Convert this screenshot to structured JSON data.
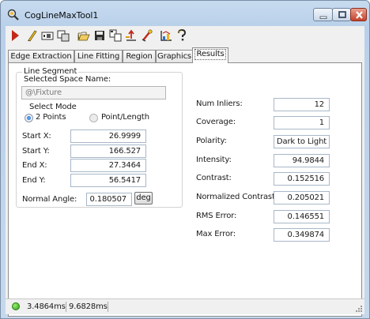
{
  "window": {
    "title": "CogLineMaxTool1"
  },
  "colors": {
    "accent": "#1a5fbf",
    "status_ok": "#2f9e1c",
    "title_gradient": "#b9d0ea",
    "close_button": "#c4422b"
  },
  "toolbar": {
    "buttons": [
      "run-icon",
      "edit-tool-icon",
      "image-display-icon",
      "copy-image-icon",
      "open-icon",
      "save-icon",
      "copy-icon",
      "reset-icon",
      "properties-icon",
      "chart-icon",
      "help-icon"
    ]
  },
  "tabs": [
    {
      "label": "Edge Extraction"
    },
    {
      "label": "Line Fitting"
    },
    {
      "label": "Region"
    },
    {
      "label": "Graphics"
    },
    {
      "label": "Results",
      "active": true
    }
  ],
  "line_segment": {
    "title": "Line Segment",
    "space_name_label": "Selected Space Name:",
    "space_name_value": "@\\Fixture",
    "select_mode": {
      "label": "Select Mode",
      "option_2points": "2 Points",
      "option_pointlength": "Point/Length",
      "selected": "2 Points"
    },
    "rows": [
      {
        "label": "Start X:",
        "value": "26.9999"
      },
      {
        "label": "Start Y:",
        "value": "166.527"
      },
      {
        "label": "End X:",
        "value": "27.3464"
      },
      {
        "label": "End Y:",
        "value": "56.5417"
      }
    ],
    "normal_angle": {
      "label": "Normal Angle:",
      "value": "0.180507",
      "unit_button": "deg"
    }
  },
  "results": [
    {
      "label": "Num Inliers:",
      "value": "12"
    },
    {
      "label": "Coverage:",
      "value": "1"
    },
    {
      "label": "Polarity:",
      "value": "Dark to Light"
    },
    {
      "label": "Intensity:",
      "value": "94.9844"
    },
    {
      "label": "Contrast:",
      "value": "0.152516"
    },
    {
      "label": "Normalized Contrast:",
      "value": "0.205021"
    },
    {
      "label": "RMS Error:",
      "value": "0.146551"
    },
    {
      "label": "Max Error:",
      "value": "0.349874"
    }
  ],
  "status": {
    "time1": "3.4864ms",
    "time2": "9.6828ms"
  }
}
